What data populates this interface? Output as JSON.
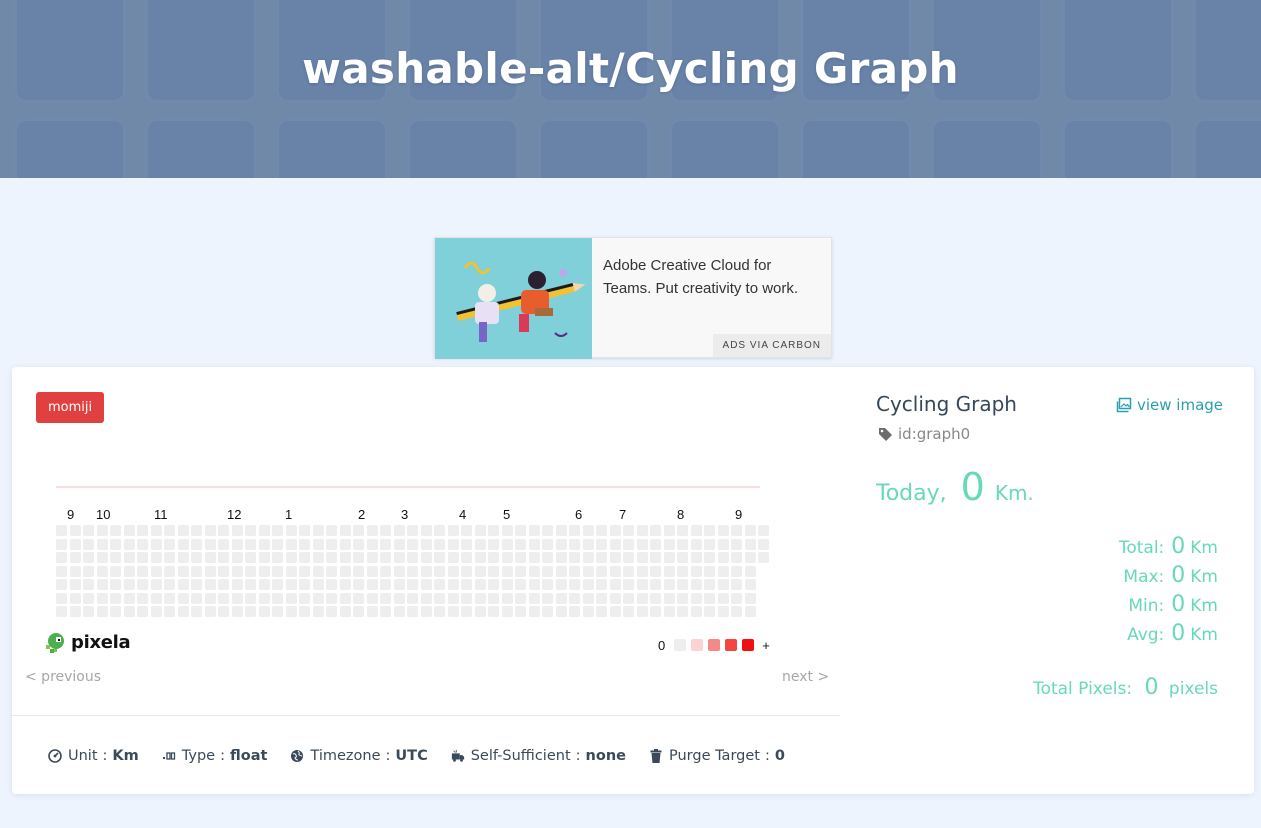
{
  "header": {
    "title": "washable-alt/Cycling Graph"
  },
  "ad": {
    "text": "Adobe Creative Cloud for Teams. Put creativity to work.",
    "via": "ADS VIA CARBON"
  },
  "user_badge": "momiji",
  "graph": {
    "month_labels": [
      "9",
      "10",
      "11",
      "12",
      "1",
      "2",
      "3",
      "4",
      "5",
      "6",
      "7",
      "8",
      "9"
    ],
    "legend": {
      "low": "0",
      "high": "+",
      "colors": [
        "#eeeeee",
        "#fcd3d3",
        "#f78888",
        "#f44545",
        "#ee1111"
      ]
    },
    "empty_color": "#eeeeee",
    "logo_text": "pixela"
  },
  "pager": {
    "previous": "< previous",
    "next": "next >"
  },
  "meta": {
    "unit_label": "Unit",
    "unit_value": "Km",
    "type_label": "Type",
    "type_value": "float",
    "timezone_label": "Timezone",
    "timezone_value": "UTC",
    "self_sufficient_label": "Self-Sufficient",
    "self_sufficient_value": "none",
    "purge_label": "Purge Target",
    "purge_value": "0",
    "separator": ":"
  },
  "side": {
    "graph_name": "Cycling Graph",
    "view_image": "view image",
    "graph_id": "id:graph0",
    "today_label": "Today",
    "today_comma": ",",
    "today_value": "0",
    "today_unit": "Km.",
    "stats": [
      {
        "label": "Total:",
        "value": "0",
        "unit": "Km"
      },
      {
        "label": "Max:",
        "value": "0",
        "unit": "Km"
      },
      {
        "label": "Min:",
        "value": "0",
        "unit": "Km"
      },
      {
        "label": "Avg:",
        "value": "0",
        "unit": "Km"
      }
    ],
    "total_pixels_label": "Total Pixels:",
    "total_pixels_value": "0",
    "total_pixels_unit": "pixels"
  },
  "colors": {
    "accent": "#67d9b9",
    "badge": "#e0403f",
    "link": "#2a9fb0"
  }
}
